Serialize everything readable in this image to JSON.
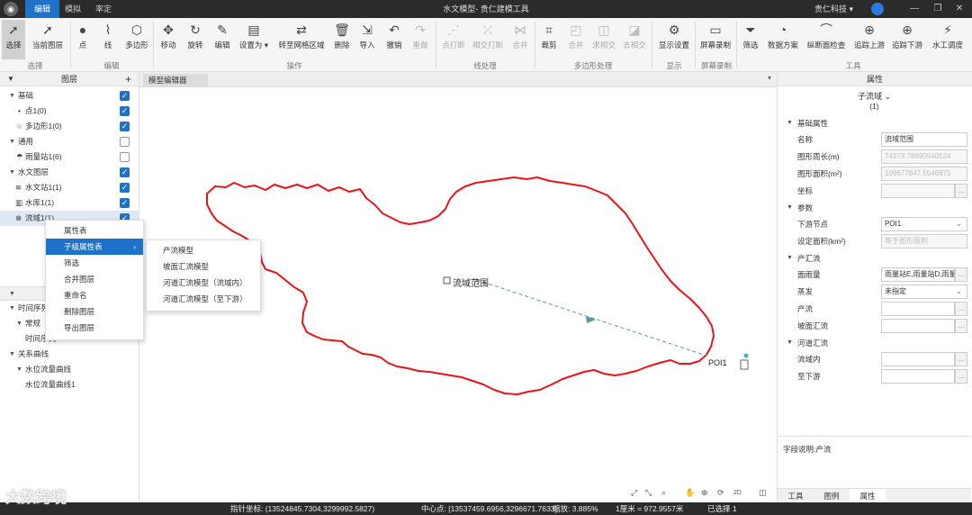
{
  "titlebar": {
    "menus": [
      "编辑",
      "模拟",
      "率定"
    ],
    "title": "水文模型- 贵仁建模工具",
    "user": "贵仁科技 ▾"
  },
  "ribbon": {
    "buttons": [
      "选择",
      "当前图层",
      "点",
      "线",
      "多边形",
      "移动",
      "旋转",
      "编辑",
      "设置为 ▾",
      "转至网格区域",
      "删除",
      "导入",
      "撤销",
      "重做",
      "点打断",
      "相交打断",
      "合并",
      "裁剪",
      "合并",
      "求相交",
      "去相交",
      "显示设置",
      "屏幕录制",
      "筛选",
      "数据方案",
      "纵断面检查",
      "追踪上游",
      "追踪下游",
      "水工调度"
    ],
    "groups": [
      "选择",
      "编辑",
      "操作",
      "线处理",
      "多边形处理",
      "显示",
      "屏幕录制",
      "工具"
    ]
  },
  "layers": {
    "header": "图层",
    "rows": [
      "基础",
      "点1(0)",
      "多边形1(0)",
      "通用",
      "雨量站1(6)",
      "水文图层",
      "水文站1(1)",
      "水库1(1)",
      "流域1(1)"
    ],
    "lower_rows": [
      "时间序列",
      "常规",
      "时间序列",
      "关系曲线",
      "水位流量曲线",
      "水位流量曲线1"
    ]
  },
  "context_menu": [
    "属性表",
    "子级属性表",
    "筛选",
    "合并图层",
    "重命名",
    "删除图层",
    "导出图层"
  ],
  "submenu": [
    "产流模型",
    "坡面汇流模型",
    "河道汇流模型（流域内）",
    "河道汇流模型（至下游）"
  ],
  "editor": {
    "tab": "模型编辑器",
    "feature_label": "流域范围",
    "poi_label": "POI1",
    "map_tools": [
      "⤢",
      "⤡",
      "⌕",
      "✋",
      "⊕",
      "⟳",
      "2D",
      "◫"
    ]
  },
  "properties": {
    "header": "属性",
    "selector": "子流域 ⌄",
    "count": "(1)",
    "sections": [
      "基础属性",
      "参数",
      "产汇流",
      "河道汇流"
    ],
    "fields": {
      "name": {
        "label": "名称",
        "value": "流域范围"
      },
      "perimeter": {
        "label": "图形周长(m)",
        "value": "74373.78890540524"
      },
      "area": {
        "label": "图形面积(m²)",
        "value": "109677847.5546875"
      },
      "coords": {
        "label": "坐标",
        "value": ""
      },
      "downstream": {
        "label": "下游节点",
        "value": "POI1"
      },
      "set_area": {
        "label": "设定面积(km²)",
        "value": "等于图形面积"
      },
      "rainfall": {
        "label": "面雨量",
        "value": "雨量站E,雨量站D,雨量"
      },
      "evap": {
        "label": "蒸发",
        "value": "未指定"
      },
      "runoff": {
        "label": "产流",
        "value": ""
      },
      "slope": {
        "label": "坡面汇流",
        "value": ""
      },
      "inner": {
        "label": "流域内",
        "value": ""
      },
      "down": {
        "label": "至下游",
        "value": ""
      }
    },
    "description": "字段说明:产流",
    "tabs": [
      "工具",
      "图例",
      "属性"
    ]
  },
  "status": {
    "pointer": "指针坐标: (13524845.7304,3299992.5827)",
    "center": "中心点: [13537459.6956,3296671.7633]",
    "zoom": "缩放: 3.885%",
    "scale": "1厘米 = 972.9557米",
    "selected": "已选择 1"
  },
  "watermark": "大数跨境",
  "colors": {
    "accent": "#1e73c8",
    "boundary": "#e8141c",
    "arrow": "#5a9aa0"
  }
}
